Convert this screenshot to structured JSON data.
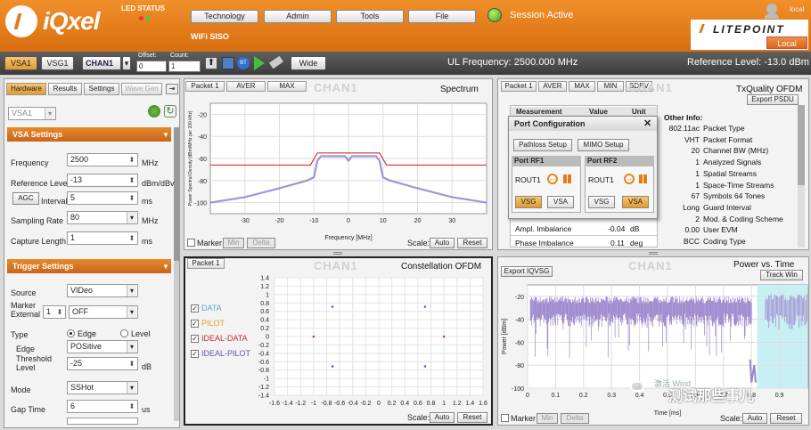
{
  "header": {
    "brand": "iQxel",
    "led_status_label": "LED STATUS",
    "mode": "WiFi SISO",
    "menu": [
      "Technology",
      "Admin",
      "Tools",
      "File"
    ],
    "session": "Session Active",
    "local_user": "local",
    "partner_logo": "LITEPOINT",
    "local_button": "Local",
    "colors": {
      "accent": "#e0781c",
      "led_red": "#ff3030",
      "led_green": "#40d040"
    }
  },
  "toolbar": {
    "vsa1": "VSA1",
    "vsg1": "VSG1",
    "chan": "CHAN1",
    "offset_label": "Offset:",
    "offset_value": "0",
    "count_label": "Count:",
    "count_value": "1",
    "wide": "Wide",
    "ul_frequency": "UL Frequency: 2500.000 MHz",
    "reference_level": "Reference Level: -13.0 dBm"
  },
  "left": {
    "tabs": [
      "Hardware",
      "Results",
      "Settings",
      "Wave Gen"
    ],
    "vsa_select": "VSA1",
    "vsa_settings_title": "VSA Settings",
    "frequency": {
      "label": "Frequency",
      "value": "2500",
      "unit": "MHz"
    },
    "ref_level": {
      "label": "Reference Level",
      "value": "-13",
      "unit": "dBm/dBv"
    },
    "agc": "AGC",
    "interval": {
      "label": "Interval",
      "value": "5",
      "unit": "ms"
    },
    "sampling": {
      "label": "Sampling Rate",
      "value": "80",
      "unit": "MHz"
    },
    "capture": {
      "label": "Capture Length",
      "value": "1",
      "unit": "ms"
    },
    "trigger_title": "Trigger Settings",
    "source": {
      "label": "Source",
      "value": "VIDeo"
    },
    "marker_external": {
      "label1": "Marker",
      "label2": "External",
      "num": "1",
      "value": "OFF"
    },
    "type": {
      "label": "Type",
      "opt1": "Edge",
      "opt2": "Level"
    },
    "edge": {
      "label": "Edge",
      "value": "POSitive"
    },
    "threshold": {
      "label1": "Threshold",
      "label2": "Level",
      "value": "-25",
      "unit": "dB"
    },
    "mode": {
      "label": "Mode",
      "value": "SSHot"
    },
    "gap": {
      "label": "Gap Time",
      "value": "6",
      "unit": "us"
    }
  },
  "spectrum": {
    "tabs": [
      "Packet 1",
      "AVER",
      "MAX"
    ],
    "watermark": "CHAN1",
    "title": "Spectrum",
    "ylabel": "Power Spectral Density [dBm/MHz per 100 kHz]",
    "xlabel": "Frequency [MHz]",
    "marker": "Marker",
    "min": "Min",
    "delta": "Delta",
    "scale": "Scale:",
    "auto": "Auto",
    "reset": "Reset"
  },
  "txquality": {
    "tabs": [
      "Packet 1",
      "AVER",
      "MAX",
      "MIN",
      "SDEV"
    ],
    "watermark": "CHAN1",
    "title": "TxQuality OFDM",
    "export": "Export PSDU",
    "headers": [
      "Measurement",
      "Value",
      "Unit"
    ],
    "rows": [
      {
        "name": "Ampl. Imbalance",
        "value": "-0.04",
        "unit": "dB"
      },
      {
        "name": "Phase Imbalance",
        "value": "0.11",
        "unit": "deg"
      }
    ],
    "other_info_title": "Other Info:",
    "info": [
      {
        "v": "802.11ac",
        "k": "Packet Type"
      },
      {
        "v": "VHT",
        "k": "Packet Format"
      },
      {
        "v": "20",
        "k": "Channel BW (MHz)"
      },
      {
        "v": "1",
        "k": "Analyzed Signals"
      },
      {
        "v": "1",
        "k": "Spatial Streams"
      },
      {
        "v": "1",
        "k": "Space-Time Streams"
      },
      {
        "v": "67",
        "k": "Symbols  64  Tones"
      },
      {
        "v": "Long",
        "k": "Guard Interval"
      },
      {
        "v": "2",
        "k": "Mod. & Coding Scheme"
      },
      {
        "v": "0.00",
        "k": "User EVM"
      },
      {
        "v": "BCC",
        "k": "Coding Type"
      }
    ]
  },
  "port_config": {
    "title": "Port Configuration",
    "pathloss": "Pathloss Setup",
    "mimo": "MIMO Setup",
    "rf1": "Port RF1",
    "rf2": "Port RF2",
    "rout": "ROUT1",
    "vsg": "VSG",
    "vsa": "VSA"
  },
  "constellation": {
    "tab": "Packet 1",
    "watermark": "CHAN1",
    "title": "Constellation OFDM",
    "legend": [
      {
        "label": "DATA",
        "color": "#5aa8c8"
      },
      {
        "label": "PILOT",
        "color": "#e0a020"
      },
      {
        "label": "IDEAL-DATA",
        "color": "#c03030"
      },
      {
        "label": "IDEAL-PILOT",
        "color": "#6a50b0"
      }
    ],
    "scale": "Scale:",
    "auto": "Auto",
    "reset": "Reset"
  },
  "power": {
    "export": "Export IQVSG",
    "watermark": "CHAN1",
    "title": "Power vs. Time",
    "track": "Track Win",
    "ylabel": "Power [dBm]",
    "xlabel": "Time [ms]",
    "marker": "Marker",
    "min": "Min",
    "delta": "Delta",
    "scale": "Scale:",
    "auto": "Auto",
    "reset": "Reset",
    "overlay": "测试那些事儿",
    "overlay_small": "激活 Wind"
  },
  "chart_data": [
    {
      "type": "line",
      "name": "spectrum",
      "title": "Spectrum",
      "xlabel": "Frequency [MHz]",
      "ylabel": "Power Spectral Density [dBm/MHz per 100 kHz]",
      "xlim": [
        -40,
        40
      ],
      "ylim": [
        -110,
        -10
      ],
      "xticks": [
        -30,
        -20,
        -10,
        0,
        10,
        20,
        30
      ],
      "yticks": [
        -20,
        -40,
        -60,
        -80,
        -100
      ],
      "series": [
        {
          "name": "mask",
          "color": "#e03030",
          "x": [
            -40,
            -11,
            -9,
            9,
            11,
            40
          ],
          "y": [
            -66,
            -66,
            -55,
            -55,
            -66,
            -66
          ]
        },
        {
          "name": "psd",
          "color": "#8a7ad0",
          "x": [
            -40,
            -30,
            -20,
            -12,
            -10,
            -9,
            -8,
            -1,
            0,
            1,
            8,
            9,
            10,
            12,
            20,
            30,
            40
          ],
          "y": [
            -100,
            -95,
            -87,
            -80,
            -77,
            -62,
            -58,
            -58,
            -62,
            -58,
            -58,
            -62,
            -77,
            -80,
            -87,
            -95,
            -100
          ]
        }
      ]
    },
    {
      "type": "scatter",
      "name": "constellation",
      "title": "Constellation OFDM",
      "xlim": [
        -1.6,
        1.6
      ],
      "ylim": [
        -1.4,
        1.4
      ],
      "xticks": [
        -1.6,
        -1.4,
        -1.2,
        -1,
        -0.8,
        -0.6,
        -0.4,
        -0.2,
        0,
        0.2,
        0.4,
        0.6,
        0.8,
        1,
        1.2,
        1.4,
        1.6
      ],
      "yticks": [
        1.4,
        1.2,
        1,
        0.8,
        0.6,
        0.4,
        0.2,
        0,
        -0.2,
        -0.4,
        -0.6,
        -0.8,
        -1,
        -1.2,
        -1.4
      ],
      "series": [
        {
          "name": "DATA",
          "color": "#5a6aa8",
          "x": [
            -0.71,
            0.71,
            -0.71,
            0.71
          ],
          "y": [
            0.71,
            0.71,
            -0.71,
            -0.71
          ]
        },
        {
          "name": "IDEAL-PILOT",
          "color": "#d04020",
          "x": [
            -1,
            1
          ],
          "y": [
            0,
            0
          ]
        }
      ]
    },
    {
      "type": "line",
      "name": "power_vs_time",
      "title": "Power vs. Time",
      "xlabel": "Time [ms]",
      "ylabel": "Power [dBm]",
      "xlim": [
        0,
        1
      ],
      "ylim": [
        -100,
        -10
      ],
      "xticks": [
        0,
        0.1,
        0.2,
        0.3,
        0.4,
        0.5,
        0.6,
        0.7,
        0.8,
        0.9
      ],
      "yticks": [
        -20,
        -40,
        -60,
        -80,
        -100
      ],
      "highlight": {
        "x_start": 0.82,
        "x_end": 1.0,
        "color": "#c8f0f4"
      }
    }
  ]
}
